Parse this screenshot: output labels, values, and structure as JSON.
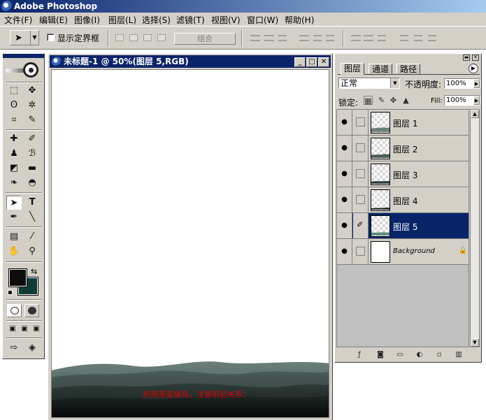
{
  "app": {
    "title": "Adobe Photoshop"
  },
  "menu": [
    "文件(F)",
    "编辑(E)",
    "图像(I)",
    "图层(L)",
    "选择(S)",
    "滤镜(T)",
    "视图(V)",
    "窗口(W)",
    "帮助(H)"
  ],
  "options": {
    "show_bounds_label": "显示定界框",
    "combine_label": "组合"
  },
  "document": {
    "title": "未标题-1 @ 50%(图层 5,RGB)",
    "note": "利用渐变填充，注意前后关系："
  },
  "colors": {
    "foreground": "#0c0c0c",
    "background": "#103c36",
    "selection": "#0a246a"
  },
  "layers_panel": {
    "tabs": [
      "图层",
      "通道",
      "路径"
    ],
    "blend_mode": "正常",
    "opacity_label": "不透明度:",
    "opacity_value": "100%",
    "lock_label": "锁定:",
    "fill_label": "Fill:",
    "fill_value": "100%",
    "layers": [
      {
        "name": "图层 1",
        "visible": true
      },
      {
        "name": "图层 2",
        "visible": true
      },
      {
        "name": "图层 3",
        "visible": true
      },
      {
        "name": "图层 4",
        "visible": true
      },
      {
        "name": "图层 5",
        "visible": true,
        "selected": true
      },
      {
        "name": "Background",
        "visible": true,
        "locked": true
      }
    ]
  }
}
